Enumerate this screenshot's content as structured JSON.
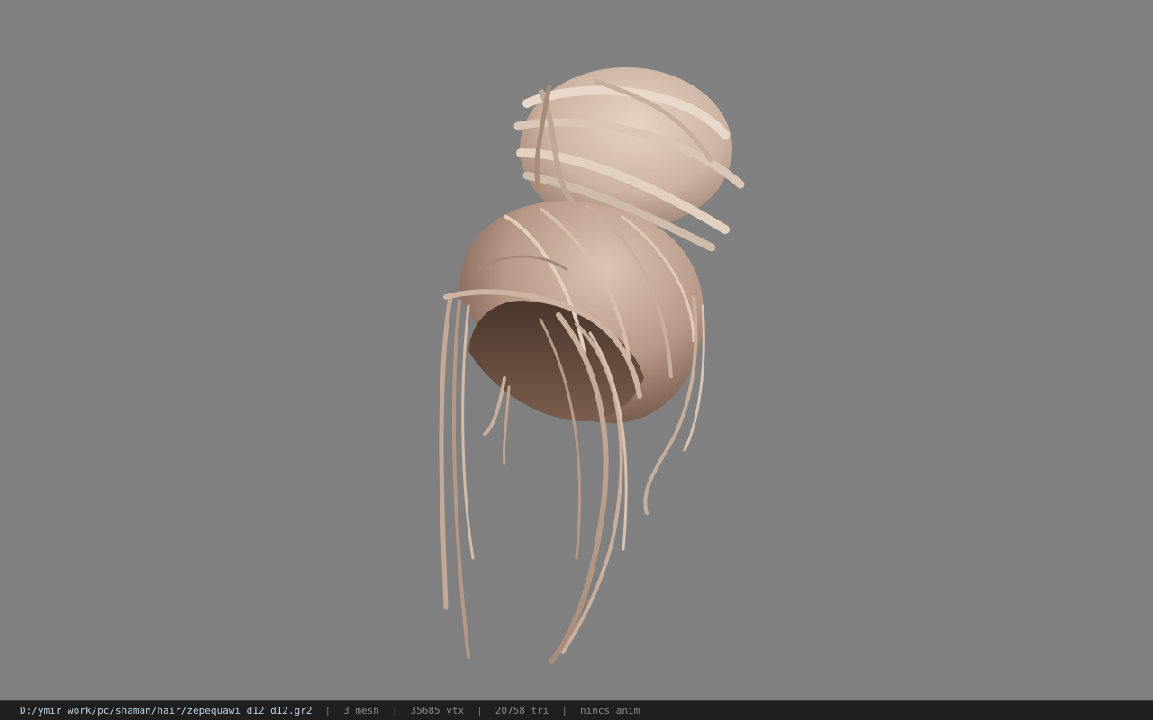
{
  "viewport": {
    "background_color": "#808080",
    "model": "hair-bun-model",
    "hair_colors": [
      "#d9bfae",
      "#b89886",
      "#6e5346",
      "#e6d3c2"
    ]
  },
  "statusbar": {
    "file_path": "D:/ymir work/pc/shaman/hair/zepequawi_d12_d12.gr2",
    "separator": "|",
    "mesh_count": "3 mesh",
    "vertex_count": "35685 vtx",
    "triangle_count": "20758 tri",
    "anim_status": "nincs anim"
  }
}
